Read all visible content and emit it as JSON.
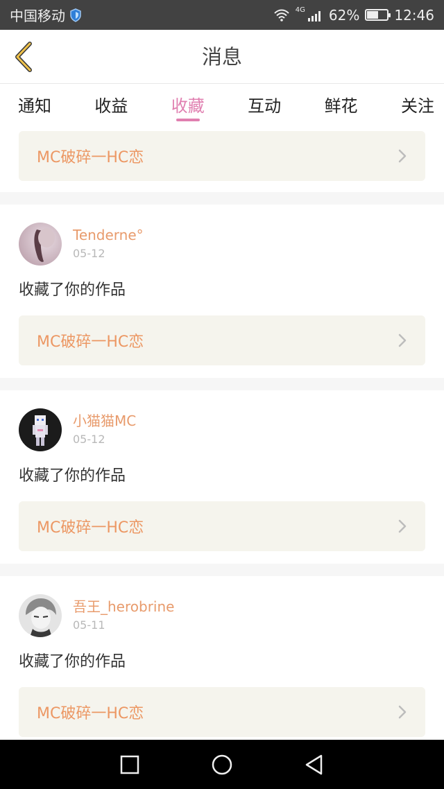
{
  "status_bar": {
    "carrier": "中国移动",
    "network": "4G",
    "battery": "62%",
    "battery_level": 0.62,
    "time": "12:46"
  },
  "header": {
    "title": "消息",
    "back_icon": "chevron-left-icon"
  },
  "tabs": [
    {
      "label": "通知",
      "active": false
    },
    {
      "label": "收益",
      "active": false
    },
    {
      "label": "收藏",
      "active": true
    },
    {
      "label": "互动",
      "active": false
    },
    {
      "label": "鲜花",
      "active": false
    },
    {
      "label": "关注",
      "active": false
    }
  ],
  "top_card": {
    "work_title": "MC破碎一HC恋"
  },
  "feed": [
    {
      "user": "Tenderne°",
      "date": "05-12",
      "action": "收藏了你的作品",
      "work_title": "MC破碎一HC恋"
    },
    {
      "user": "小猫猫MC",
      "date": "05-12",
      "action": "收藏了你的作品",
      "work_title": "MC破碎一HC恋"
    },
    {
      "user": "吾王_herobrine",
      "date": "05-11",
      "action": "收藏了你的作品",
      "work_title": "MC破碎一HC恋"
    }
  ],
  "colors": {
    "accent": "#e07fb0",
    "username": "#e89b6c",
    "work_title": "#ec9763",
    "back_arrow": "#f0c24a"
  },
  "nav": [
    "square-icon",
    "circle-icon",
    "triangle-back-icon"
  ]
}
